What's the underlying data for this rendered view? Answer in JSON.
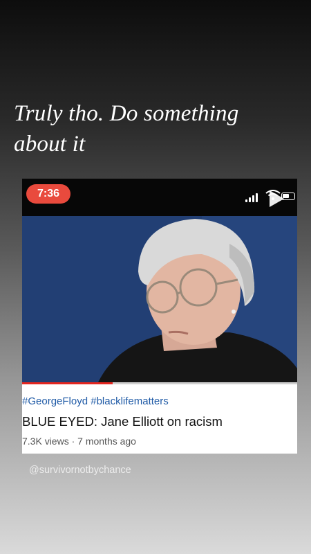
{
  "story": {
    "caption": "Truly tho. Do something about it",
    "mention": "@survivornotbychance"
  },
  "video_card": {
    "status_time": "7:36",
    "hashtags": "#GeorgeFloyd #blacklifematters",
    "title": "BLUE EYED: Jane Elliott on racism",
    "meta": "7.3K views · 7 months ago",
    "progress_fraction": 0.33
  },
  "colors": {
    "time_pill": "#e94a3d",
    "hashtag": "#1f5aa6",
    "progress": "#e5261f"
  }
}
